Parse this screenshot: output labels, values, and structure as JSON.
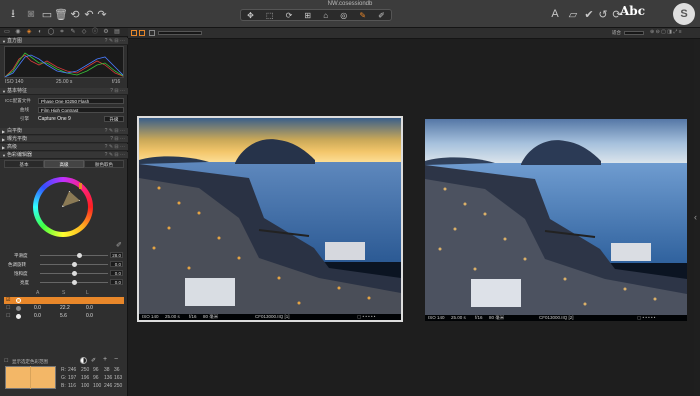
{
  "window": {
    "title": "NW.cosessiondb"
  },
  "topbar": {
    "abc_label": "Abc",
    "app_badge": "S"
  },
  "secondary": {
    "zoom_label": "适合"
  },
  "sidebar": {
    "sections": {
      "histogram": "直方图",
      "base": "基本特征",
      "white_balance": "白平衡",
      "exposure": "曝光平衡",
      "hdr": "高级",
      "color": "色彩编辑器"
    },
    "histogram": {
      "iso": "ISO 140",
      "shutter": "25.00 s",
      "aperture": "f/16"
    },
    "base": {
      "icc_label": "ICC配置文件",
      "icc_value": "Phase One IQ250 Flash",
      "curve_label": "曲线",
      "curve_value": "Film High Contrast",
      "engine_label": "引擎",
      "engine_value": "Capture One 9",
      "engine_btn": "升级"
    },
    "color_tabs": [
      "基本",
      "高级",
      "肤色取色"
    ],
    "sliders": [
      {
        "label": "平滑度",
        "value": "28.0",
        "pos": 0.55
      },
      {
        "label": "色调旋转",
        "value": "0.0",
        "pos": 0.5
      },
      {
        "label": "饱和度",
        "value": "0.0",
        "pos": 0.5
      },
      {
        "label": "亮度",
        "value": "0.0",
        "pos": 0.5
      }
    ],
    "table_headers": [
      "A",
      "S",
      "L"
    ],
    "table_rows": [
      {
        "a": "",
        "s": "",
        "l": ""
      },
      {
        "a": "0.0",
        "s": "22.2",
        "l": "0.0"
      },
      {
        "a": "0.0",
        "s": "5.6",
        "l": "0.0"
      }
    ],
    "bottom_option": "显示选定色彩范围",
    "readout": {
      "r": [
        "246",
        "250",
        "96",
        "38",
        "36"
      ],
      "g": [
        "197",
        "196",
        "96",
        "136",
        "163"
      ],
      "b": [
        "116",
        "100",
        "100",
        "246",
        "250"
      ],
      "labels": [
        "R:",
        "G:",
        "B:"
      ]
    }
  },
  "photos": [
    {
      "iso": "ISO 140",
      "shutter": "25.00 s",
      "aperture": "f/16",
      "focal": "80 毫米",
      "name": "CF013000.IIQ [1]"
    },
    {
      "iso": "ISO 140",
      "shutter": "25.00 s",
      "aperture": "f/16",
      "focal": "80 毫米",
      "name": "CF013000.IIQ [2]"
    }
  ],
  "colors": {
    "accent": "#e8872a",
    "swatch": "#f3b767"
  }
}
